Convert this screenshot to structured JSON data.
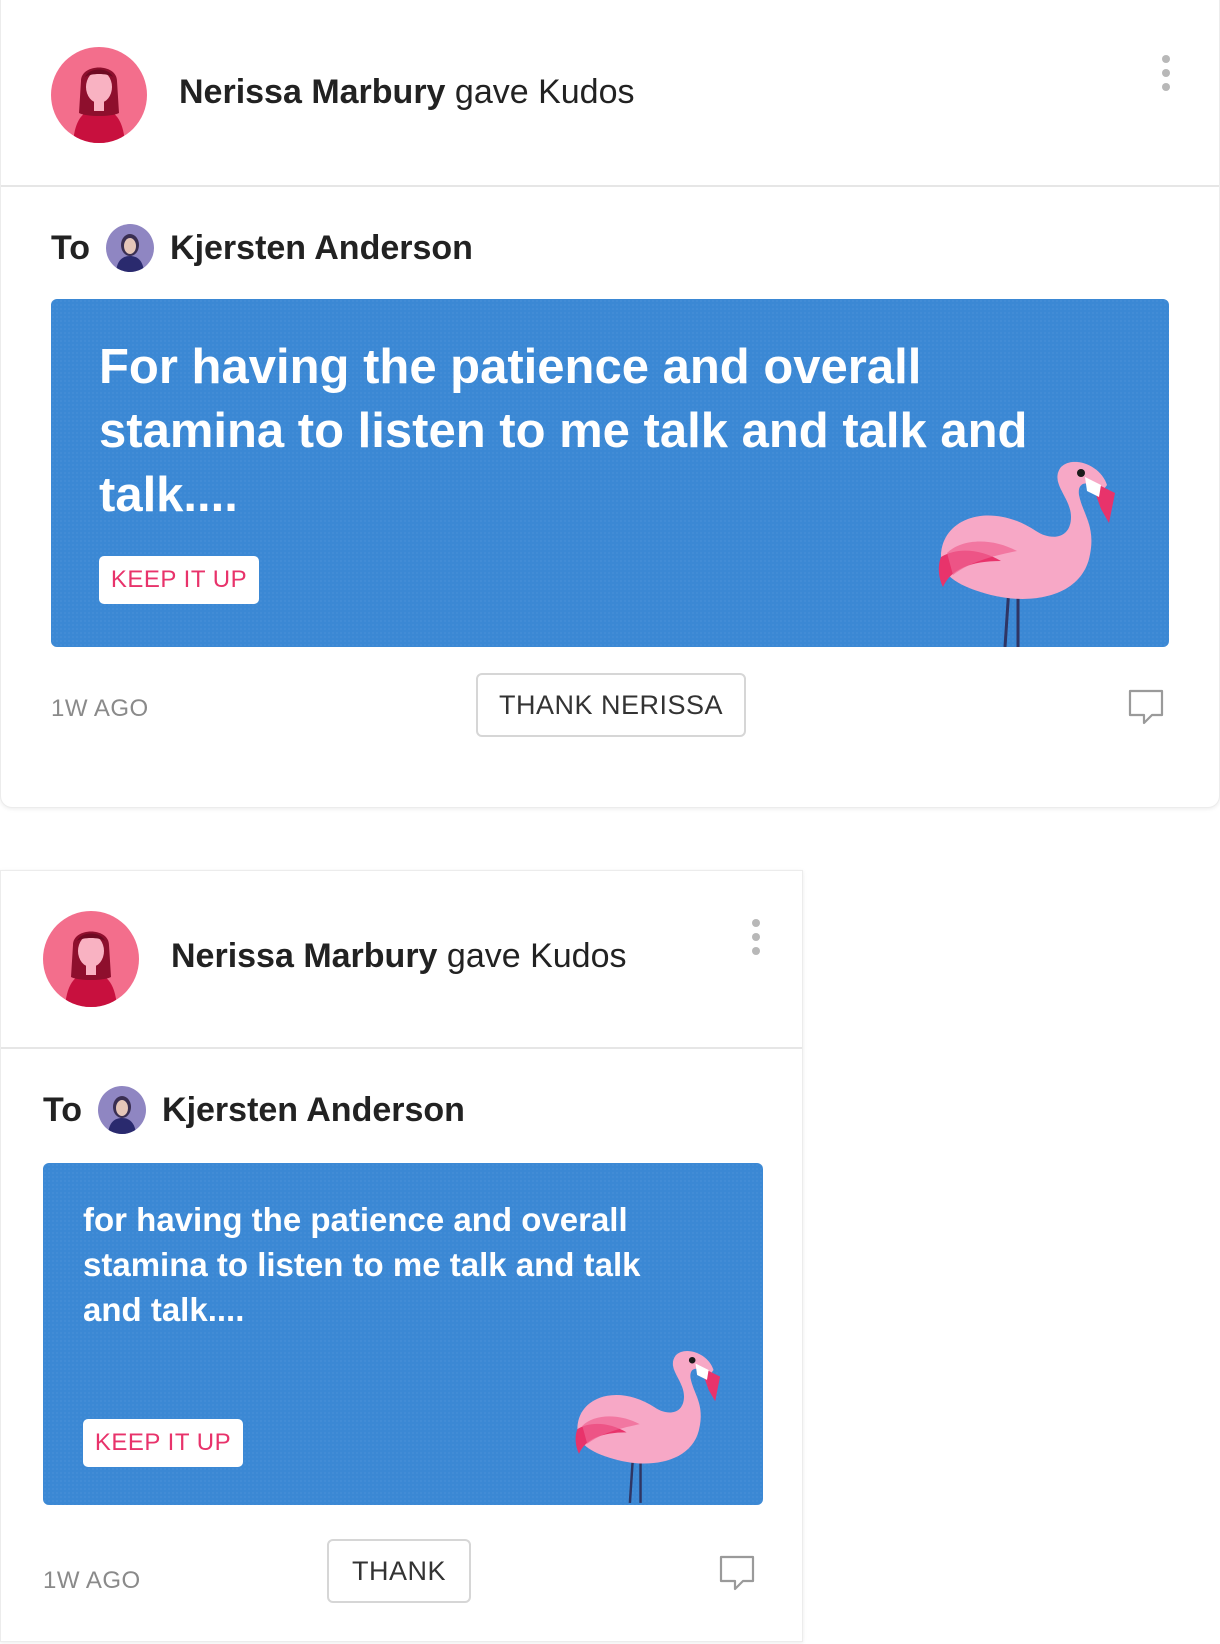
{
  "colors": {
    "banner_blue": "#3b88d4",
    "badge_text": "#e8336b",
    "flamingo_pink": "#f59bbd"
  },
  "posts": [
    {
      "sender_name": "Nerissa Marbury",
      "action_text": "gave Kudos",
      "to_label": "To",
      "recipient_name": "Kjersten Anderson",
      "message": "For having the patience and overall stamina to listen to me talk and talk and talk....",
      "badge": "KEEP IT UP",
      "time_ago": "1W AGO",
      "thank_label": "THANK NERISSA",
      "icons": [
        "more-vertical-icon",
        "comment-icon",
        "flamingo-illustration"
      ]
    },
    {
      "sender_name": "Nerissa Marbury",
      "action_text": "gave Kudos",
      "to_label": "To",
      "recipient_name": "Kjersten Anderson",
      "message": "for having the patience and overall stamina to listen to me talk and talk and talk....",
      "badge": "KEEP IT UP",
      "time_ago": "1W AGO",
      "thank_label": "THANK",
      "icons": [
        "more-vertical-icon",
        "comment-icon",
        "flamingo-illustration"
      ]
    }
  ]
}
